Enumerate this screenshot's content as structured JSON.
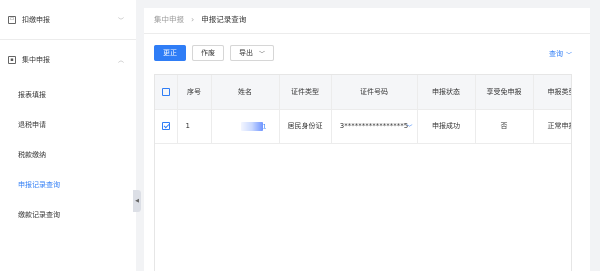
{
  "sidebar": {
    "groups": [
      {
        "label": "扣缴申报"
      },
      {
        "label": "集中申报"
      }
    ],
    "items": [
      {
        "label": "报表填报"
      },
      {
        "label": "退税申请"
      },
      {
        "label": "税款缴纳"
      },
      {
        "label": "申报记录查询"
      },
      {
        "label": "缴款记录查询"
      }
    ]
  },
  "breadcrumb": {
    "parent": "集中申报",
    "current": "申报记录查询"
  },
  "toolbar": {
    "update_label": "更正",
    "void_label": "作废",
    "export_label": "导出"
  },
  "query": {
    "label": "查询"
  },
  "table": {
    "columns": [
      "序号",
      "姓名",
      "证件类型",
      "证件号码",
      "申报状态",
      "享受免申报",
      "申报类型"
    ],
    "rows": [
      {
        "index": "1",
        "name_end": "1",
        "id_type": "居民身份证",
        "id_number": "3*****************5",
        "status": "申报成功",
        "exempt": "否",
        "decl_type": "正常申报"
      }
    ]
  },
  "colors": {
    "accent": "#2f7df6",
    "background": "#f2f3f5"
  },
  "icons": {
    "group1": "declare-icon",
    "group2": "batch-declare-icon",
    "collapse": "chevron-down-icon",
    "expand": "chevron-up-icon"
  }
}
